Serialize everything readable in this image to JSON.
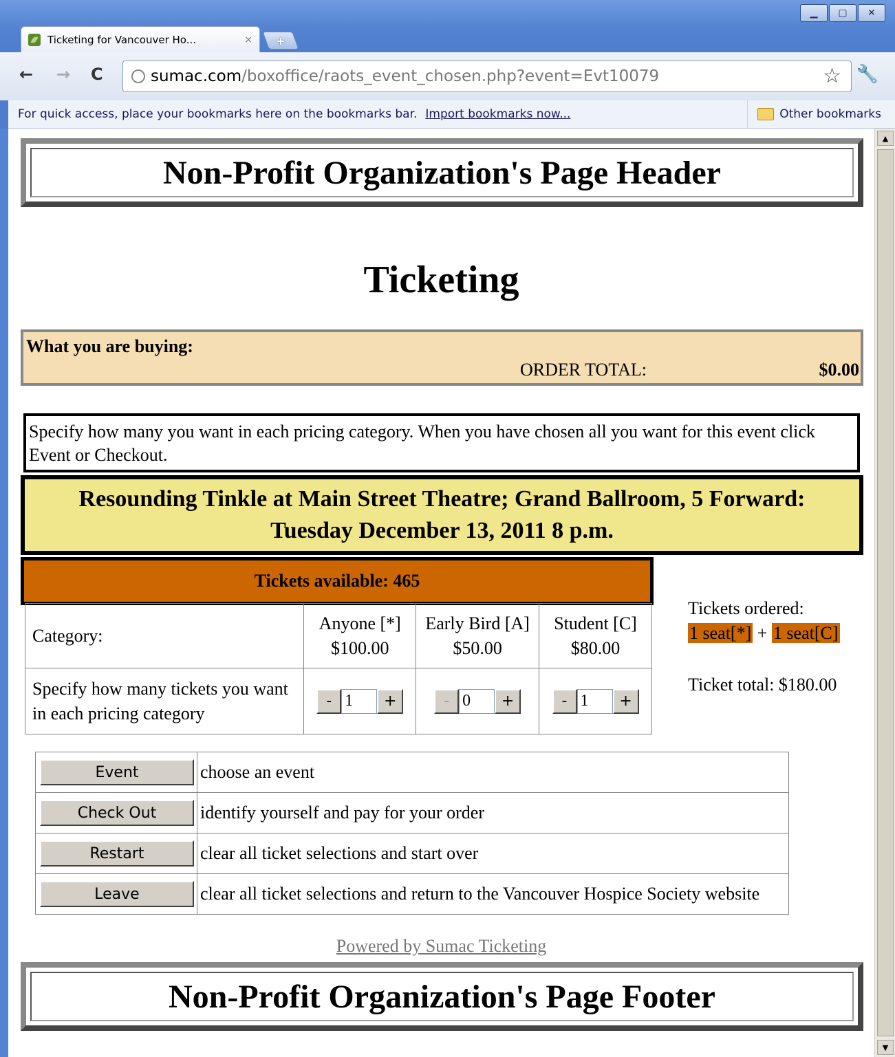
{
  "browser": {
    "tab_title": "Ticketing for Vancouver Ho...",
    "tab_close": "×",
    "new_tab": "+",
    "url_host": "sumac.com",
    "url_path": "/boxoffice/raots_event_chosen.php?event=Evt10079",
    "bookmarks_hint": "For quick access, place your bookmarks here on the bookmarks bar.",
    "import_link": "Import bookmarks now...",
    "other_bookmarks": "Other bookmarks"
  },
  "page": {
    "header": "Non-Profit Organization's Page Header",
    "title": "Ticketing",
    "buying_label": "What you are buying:",
    "order_total_label": "ORDER TOTAL:",
    "order_total_value": "$0.00",
    "instructions": "Specify how many you want in each pricing category. When you have chosen all you want for this event click Event or Checkout.",
    "event_line1": "Resounding Tinkle at Main Street Theatre; Grand Ballroom, 5 Forward:",
    "event_line2": "Tuesday December 13, 2011 8 p.m.",
    "tickets_available": "Tickets available: 465",
    "category_label": "Category:",
    "specify_label": "Specify how many tickets you want in each pricing category",
    "categories": [
      {
        "name": "Anyone [*]",
        "price": "$100.00",
        "qty": "1"
      },
      {
        "name": "Early Bird [A]",
        "price": "$50.00",
        "qty": "0"
      },
      {
        "name": "Student [C]",
        "price": "$80.00",
        "qty": "1"
      }
    ],
    "stepper_minus": "-",
    "stepper_plus": "+",
    "tickets_ordered_label": "Tickets ordered:",
    "seat_a": "1 seat[*]",
    "seat_plus": "+",
    "seat_b": "1 seat[C]",
    "ticket_total": "Ticket total: $180.00",
    "actions": [
      {
        "label": "Event",
        "desc": "choose an event"
      },
      {
        "label": "Check Out",
        "desc": "identify yourself and pay for your order"
      },
      {
        "label": "Restart",
        "desc": "clear all ticket selections and start over"
      },
      {
        "label": "Leave",
        "desc": "clear all ticket selections and return to the Vancouver Hospice Society website"
      }
    ],
    "powered_by": "Powered by Sumac Ticketing",
    "footer": "Non-Profit Organization's Page Footer"
  },
  "colors": {
    "buying_bg": "#f5deb3",
    "event_bg": "#f0e68c",
    "accent_orange": "#cc6600"
  }
}
